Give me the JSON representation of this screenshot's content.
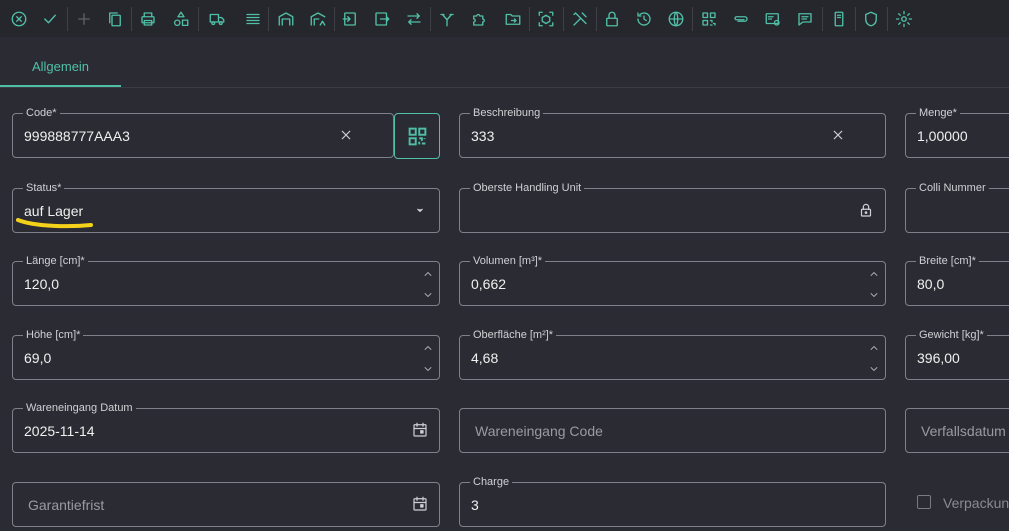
{
  "toolbar": {
    "icons": [
      "cancel-icon",
      "check-icon",
      "plus-icon",
      "copy-icon",
      "printer-icon",
      "shapes-icon",
      "truck-icon",
      "list-icon",
      "warehouse-icon",
      "warehouse-route-icon",
      "login-icon",
      "logout-icon",
      "transfer-icon",
      "merge-icon",
      "puzzle-icon",
      "folder-move-icon",
      "package-scan-icon",
      "tools-icon",
      "lock-icon",
      "history-icon",
      "globe-icon",
      "qrcode-icon",
      "paperclip-icon",
      "card-link-icon",
      "comment-icon",
      "mobile-icon",
      "shield-icon",
      "gear-icon"
    ]
  },
  "tabs": [
    {
      "label": "Allgemein",
      "active": true
    }
  ],
  "fields": {
    "code": {
      "label": "Code*",
      "value": "999888777AAA3"
    },
    "beschreibung": {
      "label": "Beschreibung",
      "value": "333"
    },
    "menge": {
      "label": "Menge*",
      "value": "1,00000"
    },
    "status": {
      "label": "Status*",
      "value": "auf Lager"
    },
    "oberste_hu": {
      "label": "Oberste Handling Unit",
      "value": ""
    },
    "colli": {
      "label": "Colli Nummer",
      "value": ""
    },
    "laenge": {
      "label": "Länge [cm]*",
      "value": "120,0"
    },
    "volumen": {
      "label": "Volumen [m³]*",
      "value": "0,662"
    },
    "breite": {
      "label": "Breite [cm]*",
      "value": "80,0"
    },
    "hoehe": {
      "label": "Höhe [cm]*",
      "value": "69,0"
    },
    "oberflaeche": {
      "label": "Oberfläche [m²]*",
      "value": "4,68"
    },
    "gewicht": {
      "label": "Gewicht [kg]*",
      "value": "396,00"
    },
    "we_datum": {
      "label": "Wareneingang Datum",
      "value": "2025-11-14"
    },
    "we_code": {
      "placeholder": "Wareneingang Code"
    },
    "verfallsdatum": {
      "placeholder": "Verfallsdatum"
    },
    "garantiefrist": {
      "placeholder": "Garantiefrist"
    },
    "charge": {
      "label": "Charge",
      "value": "3"
    },
    "verpackung": {
      "label": "Verpackung"
    }
  },
  "colors": {
    "accent": "#4fc0a6",
    "highlight": "#f5d21a",
    "background": "#2b2b33"
  }
}
